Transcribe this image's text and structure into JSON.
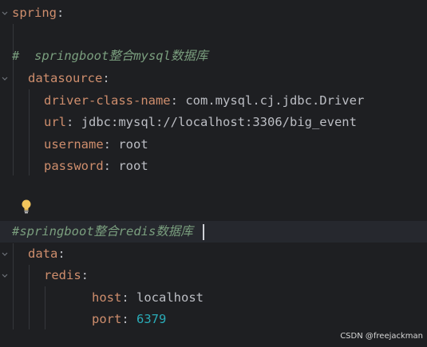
{
  "lines": {
    "spring_key": "spring",
    "colon": ":",
    "comment1": "#  springboot整合mysql数据库",
    "datasource_key": "datasource",
    "driver_key": "driver-class-name",
    "driver_val": "com.mysql.cj.jdbc.Driver",
    "url_key": "url",
    "url_val": "jdbc:mysql://localhost:3306/big_event",
    "username_key": "username",
    "username_val": "root",
    "password_key": "password",
    "password_val": "root",
    "comment2": "#springboot整合redis数据库",
    "data_key": "data",
    "redis_key": "redis",
    "host_key": "host",
    "host_val": "localhost",
    "port_key": "port",
    "port_val": "6379"
  },
  "icons": {
    "intention": "lightbulb-icon",
    "fold": "fold-chevron-icon"
  },
  "colors": {
    "background": "#1e1f22",
    "current_line": "#26282e",
    "key": "#cf8e6d",
    "comment": "#7a9e7e",
    "number": "#2aacb8",
    "text": "#bcbec4",
    "bulb": "#f2c55c"
  },
  "watermark": "CSDN @freejackman"
}
